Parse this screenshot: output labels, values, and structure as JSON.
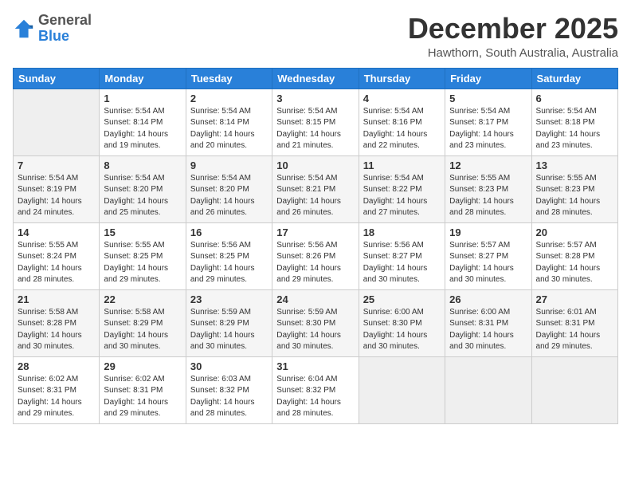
{
  "logo": {
    "general": "General",
    "blue": "Blue"
  },
  "title": "December 2025",
  "subtitle": "Hawthorn, South Australia, Australia",
  "headers": [
    "Sunday",
    "Monday",
    "Tuesday",
    "Wednesday",
    "Thursday",
    "Friday",
    "Saturday"
  ],
  "weeks": [
    [
      {
        "num": "",
        "info": ""
      },
      {
        "num": "1",
        "info": "Sunrise: 5:54 AM\nSunset: 8:14 PM\nDaylight: 14 hours\nand 19 minutes."
      },
      {
        "num": "2",
        "info": "Sunrise: 5:54 AM\nSunset: 8:14 PM\nDaylight: 14 hours\nand 20 minutes."
      },
      {
        "num": "3",
        "info": "Sunrise: 5:54 AM\nSunset: 8:15 PM\nDaylight: 14 hours\nand 21 minutes."
      },
      {
        "num": "4",
        "info": "Sunrise: 5:54 AM\nSunset: 8:16 PM\nDaylight: 14 hours\nand 22 minutes."
      },
      {
        "num": "5",
        "info": "Sunrise: 5:54 AM\nSunset: 8:17 PM\nDaylight: 14 hours\nand 23 minutes."
      },
      {
        "num": "6",
        "info": "Sunrise: 5:54 AM\nSunset: 8:18 PM\nDaylight: 14 hours\nand 23 minutes."
      }
    ],
    [
      {
        "num": "7",
        "info": "Sunrise: 5:54 AM\nSunset: 8:19 PM\nDaylight: 14 hours\nand 24 minutes."
      },
      {
        "num": "8",
        "info": "Sunrise: 5:54 AM\nSunset: 8:20 PM\nDaylight: 14 hours\nand 25 minutes."
      },
      {
        "num": "9",
        "info": "Sunrise: 5:54 AM\nSunset: 8:20 PM\nDaylight: 14 hours\nand 26 minutes."
      },
      {
        "num": "10",
        "info": "Sunrise: 5:54 AM\nSunset: 8:21 PM\nDaylight: 14 hours\nand 26 minutes."
      },
      {
        "num": "11",
        "info": "Sunrise: 5:54 AM\nSunset: 8:22 PM\nDaylight: 14 hours\nand 27 minutes."
      },
      {
        "num": "12",
        "info": "Sunrise: 5:55 AM\nSunset: 8:23 PM\nDaylight: 14 hours\nand 28 minutes."
      },
      {
        "num": "13",
        "info": "Sunrise: 5:55 AM\nSunset: 8:23 PM\nDaylight: 14 hours\nand 28 minutes."
      }
    ],
    [
      {
        "num": "14",
        "info": "Sunrise: 5:55 AM\nSunset: 8:24 PM\nDaylight: 14 hours\nand 28 minutes."
      },
      {
        "num": "15",
        "info": "Sunrise: 5:55 AM\nSunset: 8:25 PM\nDaylight: 14 hours\nand 29 minutes."
      },
      {
        "num": "16",
        "info": "Sunrise: 5:56 AM\nSunset: 8:25 PM\nDaylight: 14 hours\nand 29 minutes."
      },
      {
        "num": "17",
        "info": "Sunrise: 5:56 AM\nSunset: 8:26 PM\nDaylight: 14 hours\nand 29 minutes."
      },
      {
        "num": "18",
        "info": "Sunrise: 5:56 AM\nSunset: 8:27 PM\nDaylight: 14 hours\nand 30 minutes."
      },
      {
        "num": "19",
        "info": "Sunrise: 5:57 AM\nSunset: 8:27 PM\nDaylight: 14 hours\nand 30 minutes."
      },
      {
        "num": "20",
        "info": "Sunrise: 5:57 AM\nSunset: 8:28 PM\nDaylight: 14 hours\nand 30 minutes."
      }
    ],
    [
      {
        "num": "21",
        "info": "Sunrise: 5:58 AM\nSunset: 8:28 PM\nDaylight: 14 hours\nand 30 minutes."
      },
      {
        "num": "22",
        "info": "Sunrise: 5:58 AM\nSunset: 8:29 PM\nDaylight: 14 hours\nand 30 minutes."
      },
      {
        "num": "23",
        "info": "Sunrise: 5:59 AM\nSunset: 8:29 PM\nDaylight: 14 hours\nand 30 minutes."
      },
      {
        "num": "24",
        "info": "Sunrise: 5:59 AM\nSunset: 8:30 PM\nDaylight: 14 hours\nand 30 minutes."
      },
      {
        "num": "25",
        "info": "Sunrise: 6:00 AM\nSunset: 8:30 PM\nDaylight: 14 hours\nand 30 minutes."
      },
      {
        "num": "26",
        "info": "Sunrise: 6:00 AM\nSunset: 8:31 PM\nDaylight: 14 hours\nand 30 minutes."
      },
      {
        "num": "27",
        "info": "Sunrise: 6:01 AM\nSunset: 8:31 PM\nDaylight: 14 hours\nand 29 minutes."
      }
    ],
    [
      {
        "num": "28",
        "info": "Sunrise: 6:02 AM\nSunset: 8:31 PM\nDaylight: 14 hours\nand 29 minutes."
      },
      {
        "num": "29",
        "info": "Sunrise: 6:02 AM\nSunset: 8:31 PM\nDaylight: 14 hours\nand 29 minutes."
      },
      {
        "num": "30",
        "info": "Sunrise: 6:03 AM\nSunset: 8:32 PM\nDaylight: 14 hours\nand 28 minutes."
      },
      {
        "num": "31",
        "info": "Sunrise: 6:04 AM\nSunset: 8:32 PM\nDaylight: 14 hours\nand 28 minutes."
      },
      {
        "num": "",
        "info": ""
      },
      {
        "num": "",
        "info": ""
      },
      {
        "num": "",
        "info": ""
      }
    ]
  ]
}
